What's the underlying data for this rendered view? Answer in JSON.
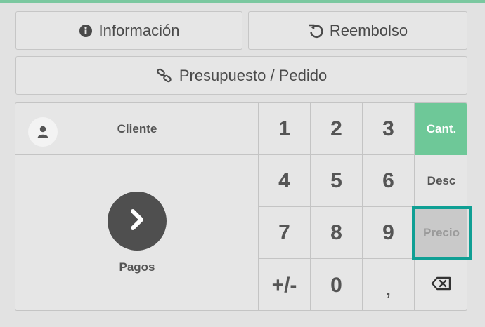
{
  "colors": {
    "accent_green": "#6ec898",
    "highlight_teal": "#0f9f94",
    "pay_circle": "#4f4f4f"
  },
  "buttons": {
    "info": {
      "label": "Información",
      "icon": "info-circle-icon"
    },
    "refund": {
      "label": "Reembolso",
      "icon": "undo-icon"
    },
    "quote": {
      "label": "Presupuesto / Pedido",
      "icon": "link-icon"
    }
  },
  "customer": {
    "label": "Cliente",
    "icon": "user-icon"
  },
  "payment": {
    "label": "Pagos",
    "icon": "chevron-right-icon"
  },
  "numpad": {
    "k1": "1",
    "k2": "2",
    "k3": "3",
    "k4": "4",
    "k5": "5",
    "k6": "6",
    "k7": "7",
    "k8": "8",
    "k9": "9",
    "sign": "+/-",
    "k0": "0",
    "decimal": ","
  },
  "modes": {
    "qty": "Cant.",
    "disc": "Desc",
    "price": "Precio",
    "backspace_icon": "backspace-icon"
  }
}
